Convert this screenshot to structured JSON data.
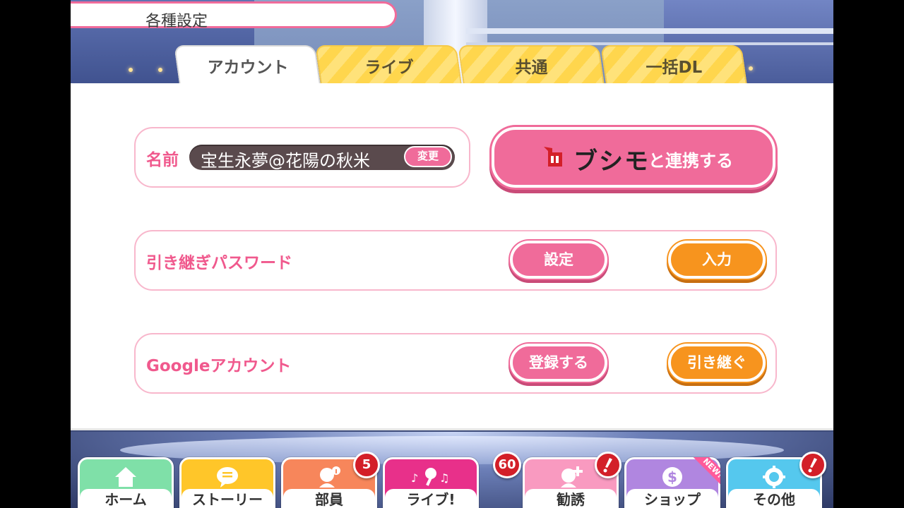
{
  "header": {
    "title": "各種設定"
  },
  "tabs": [
    {
      "label": "アカウント",
      "active": true
    },
    {
      "label": "ライブ",
      "active": false
    },
    {
      "label": "共通",
      "active": false
    },
    {
      "label": "一括DL",
      "active": false
    }
  ],
  "account": {
    "name_label": "名前",
    "name_value": "宝生永夢@花陽の秋米",
    "change_label": "変更",
    "bushimo_logo_text": "ブシモ",
    "bushimo_suffix": "と連携する",
    "transfer_label": "引き継ぎパスワード",
    "transfer_set": "設定",
    "transfer_input": "入力",
    "google_label": "Googleアカウント",
    "google_register": "登録する",
    "google_transfer": "引き継ぐ"
  },
  "nav": {
    "items": [
      {
        "label": "ホーム",
        "color": "#7fe0a8",
        "icon": "home-icon"
      },
      {
        "label": "ストーリー",
        "color": "#ffc629",
        "icon": "chat-bubble-icon"
      },
      {
        "label": "部員",
        "color": "#f7865b",
        "icon": "members-icon",
        "badge": "5"
      },
      {
        "label": "ライブ!",
        "color": "#e8308a",
        "icon": "music-mic-icon",
        "badge": "60"
      },
      {
        "label": "勧誘",
        "color": "#f99ac0",
        "icon": "recruit-icon",
        "badge": "!"
      },
      {
        "label": "ショップ",
        "color": "#b086e0",
        "icon": "coin-icon",
        "ribbon": "NEW!"
      },
      {
        "label": "その他",
        "color": "#55c8ee",
        "icon": "gear-icon",
        "badge": "!"
      }
    ]
  },
  "colors": {
    "accent_pink": "#f06b9a",
    "accent_orange": "#f7941e",
    "tab_yellow": "#ffd64d"
  }
}
